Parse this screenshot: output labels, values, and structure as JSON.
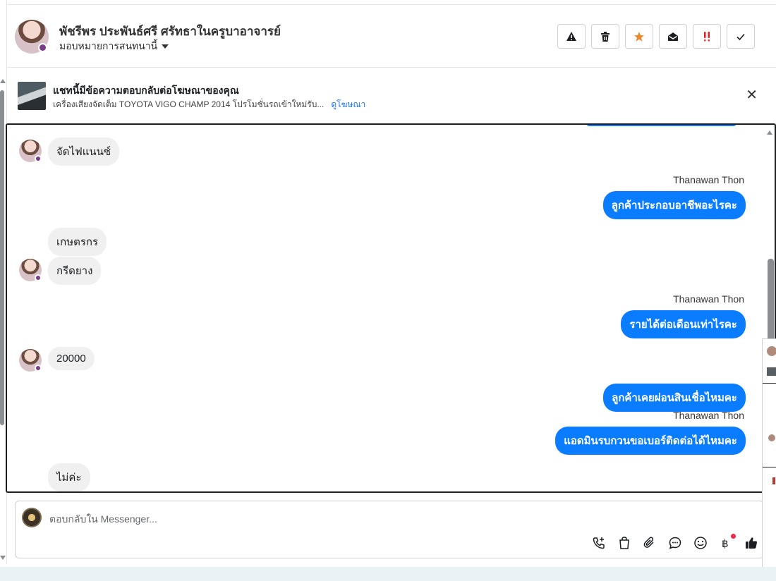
{
  "header": {
    "contact_name": "พัชรีพร ประพันธ์ศรี ศรัทธาในครูบาอาจารย์",
    "assign_label": "มอบหมายการสนทนานี้",
    "actions": [
      {
        "icon": "warning-icon"
      },
      {
        "icon": "trash-icon"
      },
      {
        "icon": "star-icon"
      },
      {
        "icon": "mark-unread-icon"
      },
      {
        "icon": "follow-up-icon"
      },
      {
        "icon": "check-icon"
      }
    ]
  },
  "ad": {
    "title": "แชทนี้มีข้อความตอบกลับต่อโฆษณาของคุณ",
    "subtitle": "เครื่องเสียงจัดเต็ม TOYOTA VIGO CHAMP 2014 โปรโมชั่นรถเข้าใหม่รับ...",
    "link": "ดูโฆษณา",
    "close": "✕"
  },
  "messages": {
    "m1": "จัดไฟแนนซ์",
    "s1": "Thanawan Thon",
    "m2": "ลูกค้าประกอบอาชีพอะไรคะ",
    "m3": "เกษตรกร",
    "m4": "กรีดยาง",
    "s2": "Thanawan Thon",
    "m5": "รายได้ต่อเดือนเท่าไรคะ",
    "m6": "20000",
    "m7": "ลูกค้าเคยผ่อนสินเชื่อไหมคะ",
    "s3": "Thanawan Thon",
    "m8": "แอดมินรบกวนขอเบอร์ติดต่อได้ไหมคะ",
    "m9": "ไม่ค่ะ"
  },
  "composer": {
    "placeholder": "ตอบกลับใน Messenger...",
    "tools": [
      "call-add-icon",
      "shopping-bag-icon",
      "attach-icon",
      "saved-reply-icon",
      "emoji-icon",
      "baht-icon",
      "thumbs-up-icon"
    ]
  },
  "colors": {
    "accent": "#0a7cff",
    "incoming_bubble": "#f0f0f0",
    "link": "#1b74e4",
    "star": "#e8892b",
    "follow_up": "#e02020"
  }
}
